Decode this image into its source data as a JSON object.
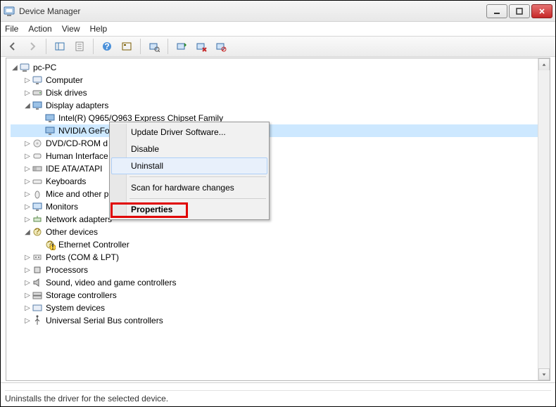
{
  "window": {
    "title": "Device Manager"
  },
  "menubar": [
    "File",
    "Action",
    "View",
    "Help"
  ],
  "tree": {
    "root": "pc-PC",
    "items": [
      {
        "label": "Computer",
        "expanded": false
      },
      {
        "label": "Disk drives",
        "expanded": false
      },
      {
        "label": "Display adapters",
        "expanded": true,
        "children": [
          {
            "label": "Intel(R)  Q965/Q963 Express Chipset Family"
          },
          {
            "label": "NVIDIA GeFo",
            "selected": true
          }
        ]
      },
      {
        "label": "DVD/CD-ROM d",
        "expanded": false
      },
      {
        "label": "Human Interface",
        "expanded": false
      },
      {
        "label": "IDE ATA/ATAPI",
        "expanded": false
      },
      {
        "label": "Keyboards",
        "expanded": false
      },
      {
        "label": "Mice and other p",
        "expanded": false
      },
      {
        "label": "Monitors",
        "expanded": false
      },
      {
        "label": "Network adapters",
        "expanded": false
      },
      {
        "label": "Other devices",
        "expanded": true,
        "children": [
          {
            "label": "Ethernet Controller",
            "warn": true
          }
        ]
      },
      {
        "label": "Ports (COM & LPT)",
        "expanded": false
      },
      {
        "label": "Processors",
        "expanded": false
      },
      {
        "label": "Sound, video and game controllers",
        "expanded": false
      },
      {
        "label": "Storage controllers",
        "expanded": false
      },
      {
        "label": "System devices",
        "expanded": false
      },
      {
        "label": "Universal Serial Bus controllers",
        "expanded": false
      }
    ]
  },
  "contextmenu": {
    "items": [
      "Update Driver Software...",
      "Disable",
      "Uninstall",
      "-",
      "Scan for hardware changes",
      "-",
      "Properties"
    ],
    "hovered": "Uninstall",
    "bold": "Properties"
  },
  "status": {
    "text": "Uninstalls the driver for the selected device."
  }
}
